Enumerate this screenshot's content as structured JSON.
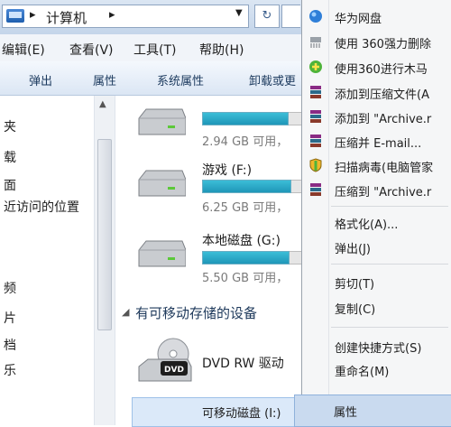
{
  "address": {
    "path": "计算机",
    "dropdown_icon": "chevron-down-icon",
    "refresh_icon": "refresh-icon"
  },
  "menubar": {
    "items": [
      "编辑(E)",
      "查看(V)",
      "工具(T)",
      "帮助(H)"
    ]
  },
  "toolbar": {
    "items": [
      "弹出",
      "属性",
      "系统属性",
      "卸载或更"
    ]
  },
  "navpane": {
    "items": [
      "夹",
      "载",
      "面",
      "近访问的位置",
      "",
      "频",
      "片",
      "档",
      "乐"
    ]
  },
  "drives": [
    {
      "name": "",
      "free": "2.94 GB 可用，",
      "used_fraction": 0.85
    },
    {
      "name": "游戏 (F:)",
      "free": "6.25 GB 可用，",
      "used_fraction": 0.88
    },
    {
      "name": "本地磁盘 (G:)",
      "free": "5.50 GB 可用，",
      "used_fraction": 0.86
    }
  ],
  "removable_section": "有可移动存储的设备",
  "dvd_label": "DVD RW 驱动",
  "dvd_icon_text": "DVD",
  "selected_drive_label": "可移动磁盘 (I:)",
  "context_menu": {
    "items": [
      {
        "label": "华为网盘",
        "icon": "huawei-cloud-icon"
      },
      {
        "label": "使用 360强力删除",
        "icon": "shredder-icon"
      },
      {
        "label": "使用360进行木马",
        "icon": "360-scan-icon"
      },
      {
        "label": "添加到压缩文件(A",
        "icon": "winrar-icon"
      },
      {
        "label": "添加到 \"Archive.r",
        "icon": "winrar-icon"
      },
      {
        "label": "压缩并 E-mail...",
        "icon": "winrar-icon"
      },
      {
        "label": "扫描病毒(电脑管家",
        "icon": "shield-icon"
      },
      {
        "label": "压缩到 \"Archive.r",
        "icon": "winrar-icon"
      },
      {
        "label": "格式化(A)...",
        "icon": ""
      },
      {
        "label": "弹出(J)",
        "icon": ""
      },
      {
        "label": "剪切(T)",
        "icon": ""
      },
      {
        "label": "复制(C)",
        "icon": ""
      },
      {
        "label": "创建快捷方式(S)",
        "icon": ""
      },
      {
        "label": "重命名(M)",
        "icon": ""
      },
      {
        "label": "属性",
        "icon": ""
      }
    ]
  },
  "colors": {
    "bar": "#1f96b8",
    "selection": "#dbe9f9",
    "menu_bg": "#f5f6f7"
  }
}
